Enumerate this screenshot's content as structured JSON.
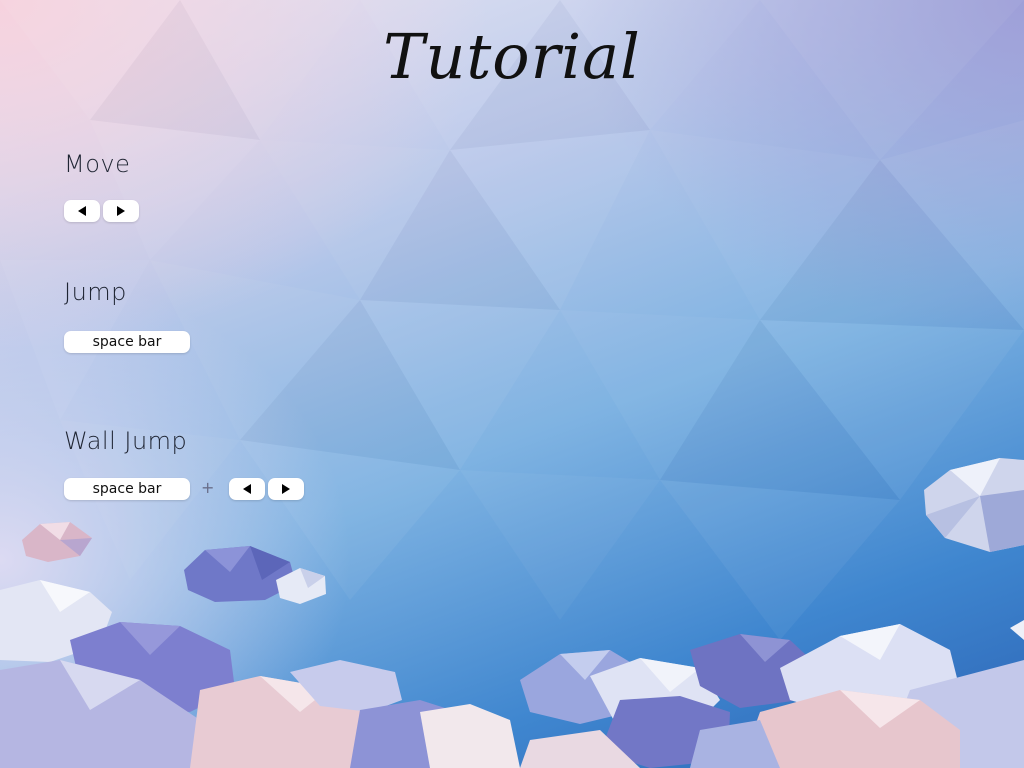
{
  "title": "Tutorial",
  "sections": {
    "move": {
      "label": "Move",
      "keys": [
        "arrow-left-key",
        "arrow-right-key"
      ]
    },
    "jump": {
      "label": "Jump",
      "key_label": "space bar"
    },
    "wall_jump": {
      "label": "Wall Jump",
      "key_label": "space bar",
      "combiner": "+"
    }
  },
  "colors": {
    "sky_top_left": "#f6d2de",
    "sky_bottom_right": "#2b63b5",
    "key_bg": "#ffffff",
    "text": "#1f2533"
  }
}
